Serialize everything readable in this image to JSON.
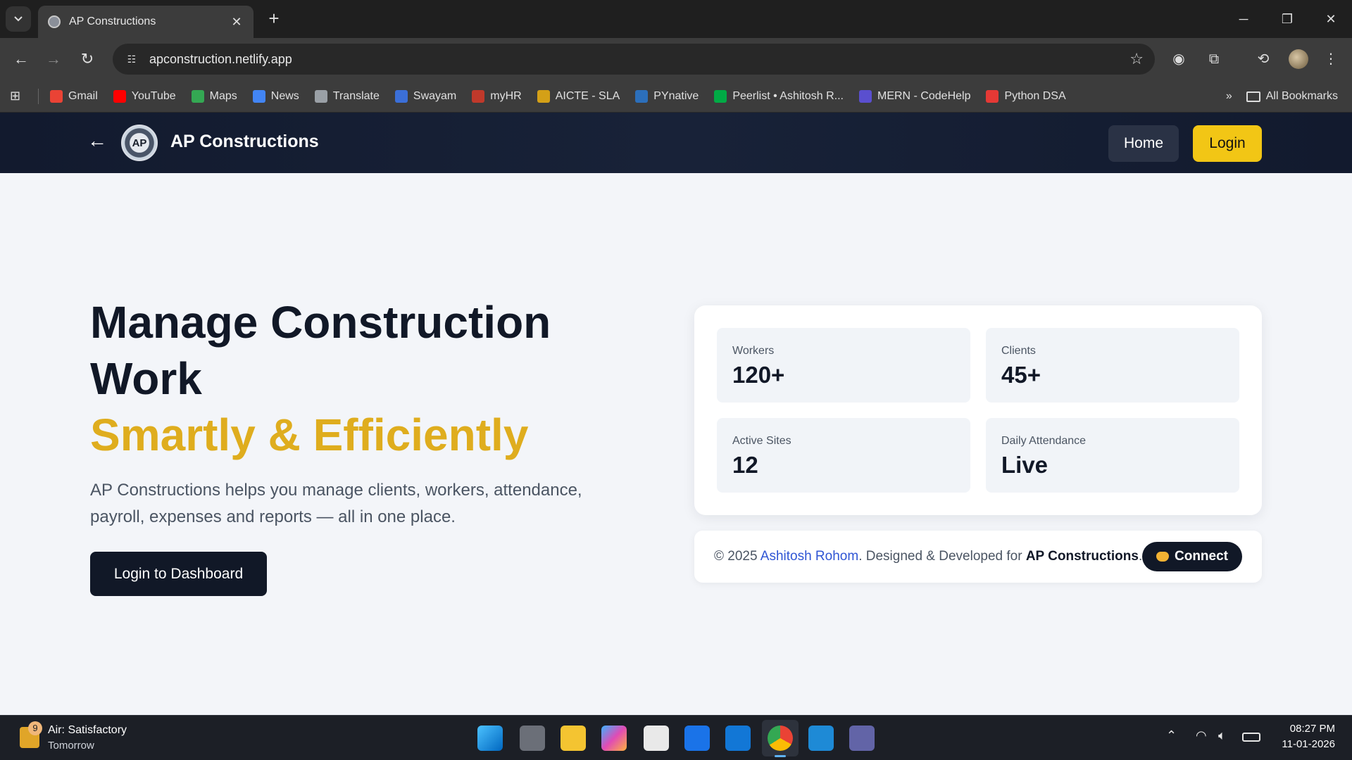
{
  "browser": {
    "tab_title": "AP Constructions",
    "url": "apconstruction.netlify.app",
    "bookmarks": [
      {
        "label": "Gmail",
        "color": "#ea4335"
      },
      {
        "label": "YouTube",
        "color": "#ff0000"
      },
      {
        "label": "Maps",
        "color": "#34a853"
      },
      {
        "label": "News",
        "color": "#4285f4"
      },
      {
        "label": "Translate",
        "color": "#9aa0a6"
      },
      {
        "label": "Swayam",
        "color": "#3b6fd8"
      },
      {
        "label": "myHR",
        "color": "#c0392b"
      },
      {
        "label": "AICTE - SLA",
        "color": "#d4a017"
      },
      {
        "label": "PYnative",
        "color": "#2c6fbb"
      },
      {
        "label": "Peerlist • Ashitosh R...",
        "color": "#00aa45"
      },
      {
        "label": "MERN - CodeHelp",
        "color": "#5a4fcf"
      },
      {
        "label": "Python DSA",
        "color": "#e53935"
      }
    ],
    "all_bookmarks": "All Bookmarks"
  },
  "header": {
    "back_icon": "arrow-left-icon",
    "logo_text": "AP",
    "brand": "AP Constructions",
    "home_label": "Home",
    "login_label": "Login",
    "accent_color": "#f2c615"
  },
  "hero": {
    "title": "Manage Construction Work",
    "accent": "Smartly & Efficiently",
    "description": "AP Constructions helps you manage clients, workers, attendance, payroll, expenses and reports — all in one place.",
    "cta_label": "Login to Dashboard"
  },
  "stats": [
    {
      "label": "Workers",
      "value": "120+"
    },
    {
      "label": "Clients",
      "value": "45+"
    },
    {
      "label": "Active Sites",
      "value": "12"
    },
    {
      "label": "Daily Attendance",
      "value": "Live"
    }
  ],
  "footer": {
    "prefix": "© 2025 ",
    "author": "Ashitosh Rohom",
    "middle": ". Designed & Developed for ",
    "company": "AP Constructions",
    "suffix": ".",
    "connect_label": "Connect"
  },
  "taskbar": {
    "weather_badge": "9",
    "weather_title": "Air: Satisfactory",
    "weather_sub": "Tomorrow",
    "time": "08:27 PM",
    "date": "11-01-2026"
  }
}
